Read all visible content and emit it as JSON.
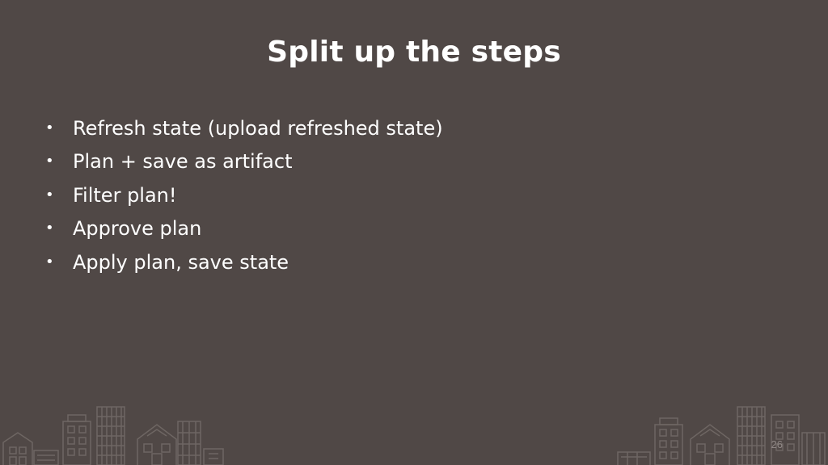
{
  "slide": {
    "title": "Split up the steps",
    "bullets": [
      "Refresh state (upload refreshed state)",
      "Plan + save as artifact",
      "Filter plan!",
      "Approve plan",
      "Apply plan, save state"
    ],
    "bullet_glyph": "•",
    "page_number": "26"
  },
  "colors": {
    "background": "#504846",
    "text": "#ffffff",
    "skyline": "#6e6663",
    "page_number": "#8f8785"
  }
}
